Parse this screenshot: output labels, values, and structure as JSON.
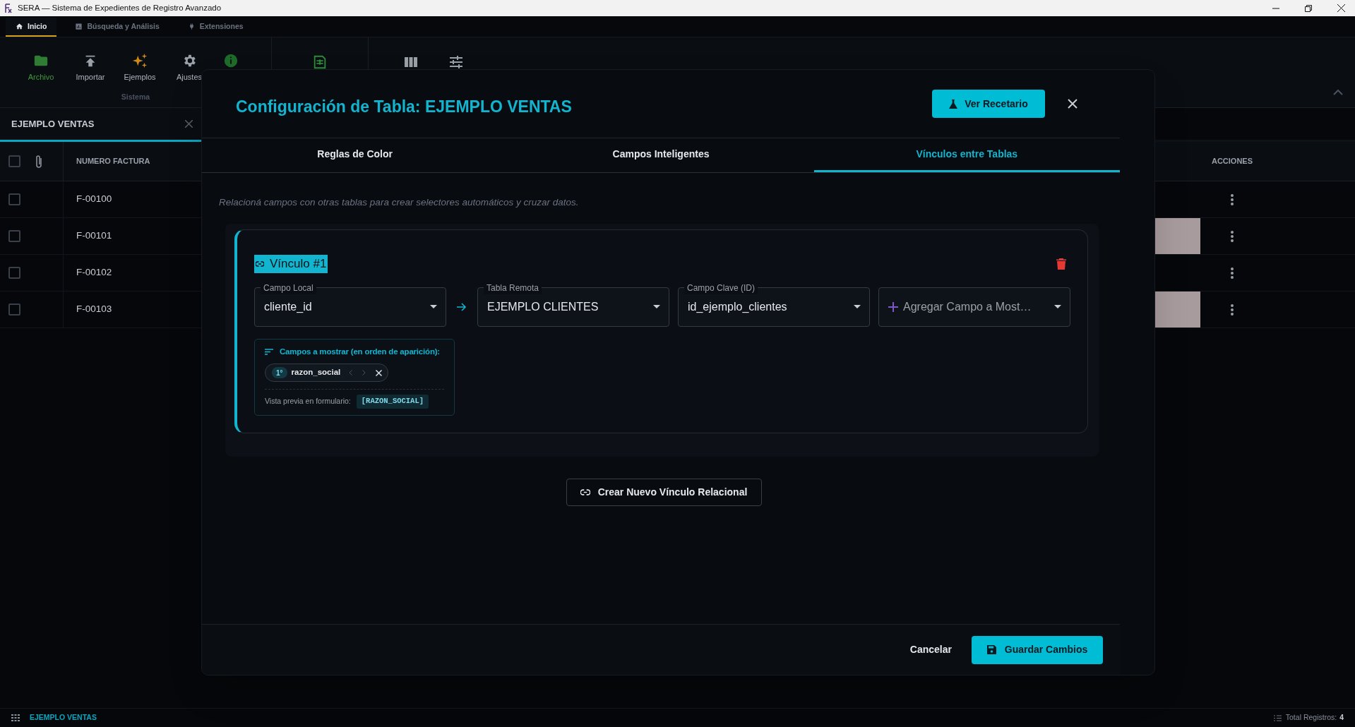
{
  "window": {
    "title": "SERA — Sistema de Expedientes de Registro Avanzado"
  },
  "ribbon_tabs": [
    {
      "label": "Inicio",
      "kind": "home",
      "selected": true
    },
    {
      "label": "Búsqueda y Análisis",
      "kind": "chart",
      "selected": false
    },
    {
      "label": "Extensiones",
      "kind": "plug",
      "selected": false
    }
  ],
  "ribbon": {
    "buttons": [
      {
        "label": "Archivo",
        "kind": "folder",
        "highlighted": true
      },
      {
        "label": "Importar",
        "kind": "upload",
        "highlighted": false
      },
      {
        "label": "Ejemplos",
        "kind": "sparkles",
        "highlighted": false
      },
      {
        "label": "Ajustes",
        "kind": "gear",
        "highlighted": false
      }
    ],
    "group_label": "Sistema"
  },
  "document_tab": {
    "title": "EJEMPLO VENTAS"
  },
  "table": {
    "header_checked": false,
    "columns": [
      "NUMERO FACTURA",
      "ACCIONES"
    ],
    "rows": [
      {
        "numero_factura": "F-00100",
        "checked": false,
        "highlighted": false
      },
      {
        "numero_factura": "F-00101",
        "checked": false,
        "highlighted": true
      },
      {
        "numero_factura": "F-00102",
        "checked": false,
        "highlighted": false
      },
      {
        "numero_factura": "F-00103",
        "checked": false,
        "highlighted": true
      }
    ]
  },
  "modal": {
    "title": "Configuración de Tabla: EJEMPLO VENTAS",
    "recipe_button": "Ver Recetario",
    "tabs": [
      {
        "label": "Reglas de Color",
        "selected": false
      },
      {
        "label": "Campos Inteligentes",
        "selected": false
      },
      {
        "label": "Vínculos entre Tablas",
        "selected": true
      }
    ],
    "description": "Relacioná campos con otras tablas para crear selectores automáticos y cruzar datos.",
    "links": [
      {
        "title": "Vínculo #1",
        "local_field": {
          "label": "Campo Local",
          "value": "cliente_id"
        },
        "remote_table": {
          "label": "Tabla Remota",
          "value": "EJEMPLO CLIENTES"
        },
        "key_field": {
          "label": "Campo Clave (ID)",
          "value": "id_ejemplo_clientes"
        },
        "add_field": {
          "placeholder": "Agregar Campo a Most…"
        },
        "display_fields": {
          "heading": "Campos a mostrar (en orden de aparición):",
          "items": [
            {
              "order": "1°",
              "name": "razon_social"
            }
          ],
          "preview_label": "Vista previa en formulario:",
          "preview_value": "[RAZON_SOCIAL]"
        }
      }
    ],
    "new_link_button": "Crear Nuevo Vínculo Relacional",
    "cancel_button": "Cancelar",
    "save_button": "Guardar Cambios"
  },
  "status_bar": {
    "table_name": "EJEMPLO VENTAS",
    "total_label": "Total Registros:",
    "total_value": "4"
  }
}
